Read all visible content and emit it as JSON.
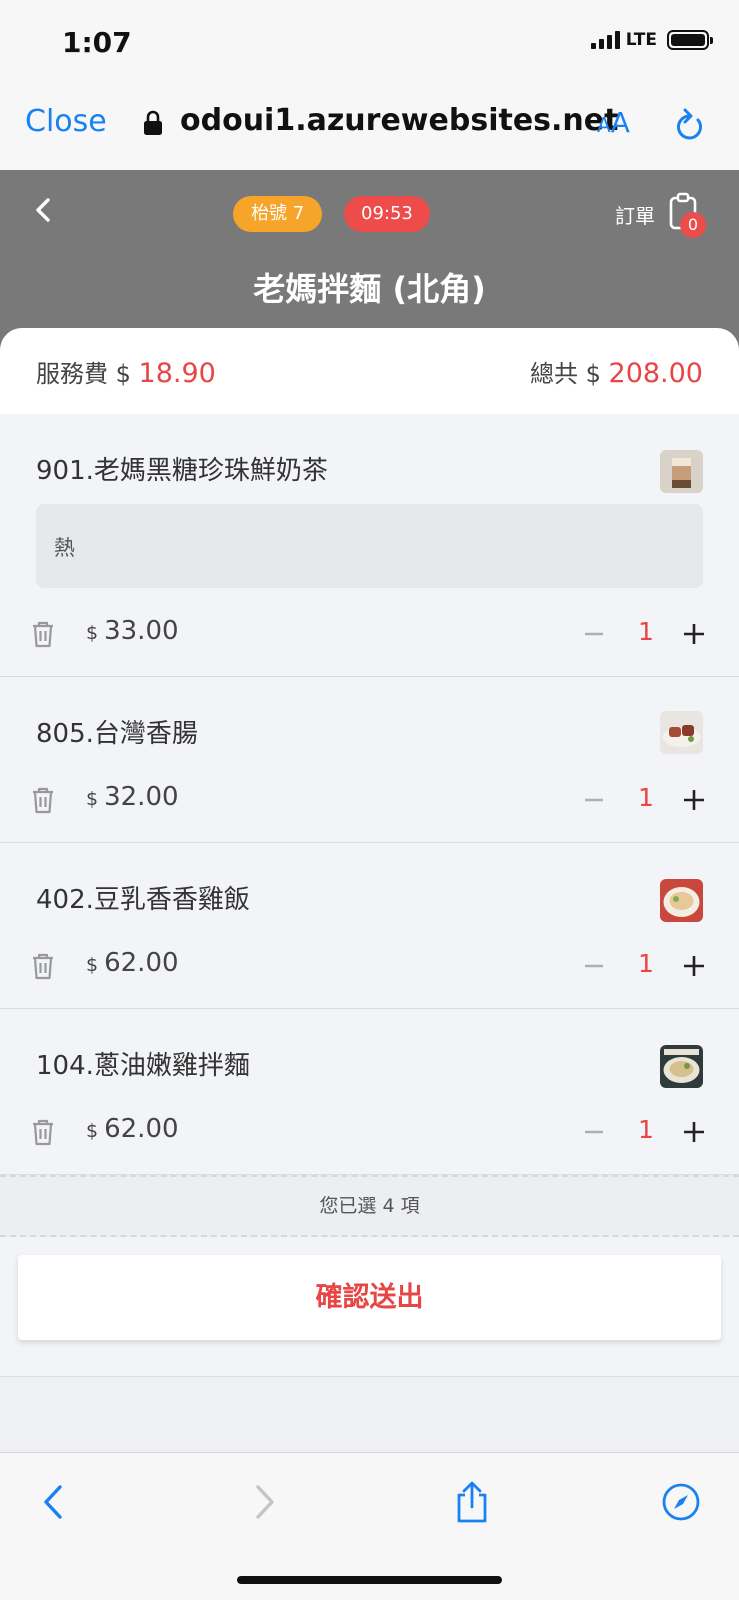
{
  "status_bar": {
    "time": "1:07",
    "network": "LTE"
  },
  "browser": {
    "close_label": "Close",
    "url": "odoui1.azurewebsites.net",
    "text_size_small": "A",
    "text_size_large": "A"
  },
  "header": {
    "table_badge": "枱號 7",
    "timer_badge": "09:53",
    "orders_label": "訂單",
    "orders_count": "0",
    "store_title": "老媽拌麵 (北角)"
  },
  "summary": {
    "service_label": "服務費 $",
    "service_value": "18.90",
    "total_label": "總共 $",
    "total_value": "208.00"
  },
  "currency_symbol": "$",
  "items": [
    {
      "name": "901.老媽黑糖珍珠鮮奶茶",
      "note": "熱",
      "price": "33.00",
      "qty": "1",
      "thumb_icon": "milk-tea-thumbnail"
    },
    {
      "name": "805.台灣香腸",
      "price": "32.00",
      "qty": "1",
      "thumb_icon": "sausage-thumbnail"
    },
    {
      "name": "402.豆乳香香雞飯",
      "price": "62.00",
      "qty": "1",
      "thumb_icon": "chicken-rice-thumbnail"
    },
    {
      "name": "104.蔥油嫩雞拌麵",
      "price": "62.00",
      "qty": "1",
      "thumb_icon": "chicken-noodle-thumbnail"
    }
  ],
  "selected_count_text": "您已選 4 項",
  "confirm_label": "確認送出",
  "colors": {
    "accent_red": "#e84545",
    "table_badge": "#f6a52a",
    "header_bg": "#797979",
    "ios_blue": "#1a82f0"
  }
}
